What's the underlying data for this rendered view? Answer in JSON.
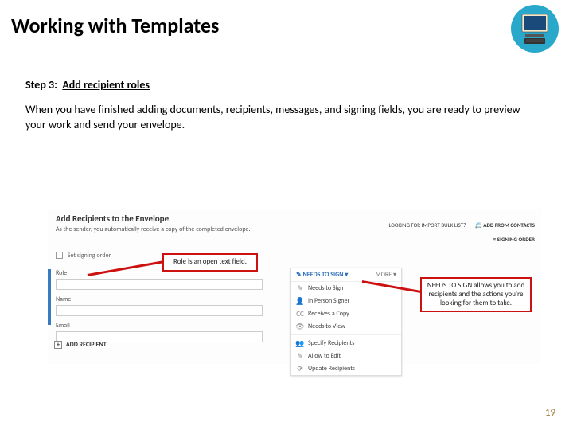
{
  "page": {
    "title": "Working with Templates",
    "number": "19"
  },
  "step": {
    "label": "Step 3:",
    "text": "Add recipient roles"
  },
  "body": "When you have finished adding documents, recipients, messages, and signing fields, you are ready to preview your work and send your envelope.",
  "screenshot": {
    "heading": "Add Recipients to the Envelope",
    "subheading": "As the sender, you automatically receive a copy of the completed envelope.",
    "topLinks": {
      "importBulk": "LOOKING FOR IMPORT BULK LIST?",
      "addFromContacts": "ADD FROM CONTACTS",
      "signingOrder": "SIGNING ORDER"
    },
    "setSigningOrder": "Set signing order",
    "form": {
      "role": "Role",
      "name": "Name",
      "email": "Email"
    },
    "addRecipient": "ADD RECIPIENT",
    "dropdown": {
      "header": "NEEDS TO SIGN",
      "more": "MORE",
      "items": [
        "Needs to Sign",
        "In Person Signer",
        "Receives a Copy",
        "Needs to View",
        "Specify Recipients",
        "Allow to Edit",
        "Update Recipients"
      ]
    }
  },
  "callouts": {
    "role": "Role is an open text field.",
    "needs": "NEEDS TO SIGN allows you to add recipients and the actions you're looking for them to take."
  },
  "icons": {
    "pen": "✎",
    "person": "👤",
    "cc": "CC",
    "eye": "👁",
    "people": "👥",
    "edit": "✎",
    "refresh": "⟳",
    "contacts": "📇",
    "order": "≡"
  }
}
